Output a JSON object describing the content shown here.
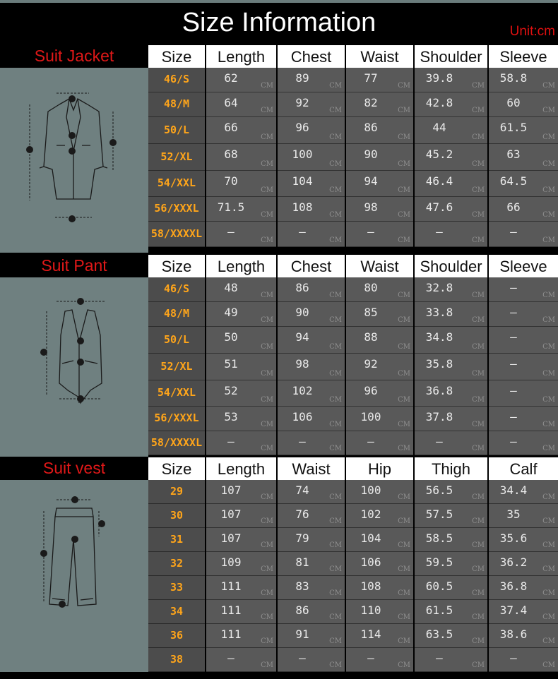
{
  "header": {
    "title": "Size Information",
    "unit": "Unit:cm"
  },
  "unit_label": "CM",
  "sections": [
    {
      "title": "Suit Jacket",
      "icon": "jacket-diagram-icon",
      "columns": [
        "Size",
        "Length",
        "Chest",
        "Waist",
        "Shoulder",
        "Sleeve"
      ],
      "rows": [
        {
          "size": "46/S",
          "values": [
            "62",
            "89",
            "77",
            "39.8",
            "58.8"
          ]
        },
        {
          "size": "48/M",
          "values": [
            "64",
            "92",
            "82",
            "42.8",
            "60"
          ]
        },
        {
          "size": "50/L",
          "values": [
            "66",
            "96",
            "86",
            "44",
            "61.5"
          ]
        },
        {
          "size": "52/XL",
          "values": [
            "68",
            "100",
            "90",
            "45.2",
            "63"
          ]
        },
        {
          "size": "54/XXL",
          "values": [
            "70",
            "104",
            "94",
            "46.4",
            "64.5"
          ]
        },
        {
          "size": "56/XXXL",
          "values": [
            "71.5",
            "108",
            "98",
            "47.6",
            "66"
          ]
        },
        {
          "size": "58/XXXXL",
          "values": [
            "—",
            "—",
            "—",
            "—",
            "—"
          ]
        }
      ]
    },
    {
      "title": "Suit Pant",
      "icon": "vest-diagram-icon",
      "columns": [
        "Size",
        "Length",
        "Chest",
        "Waist",
        "Shoulder",
        "Sleeve"
      ],
      "rows": [
        {
          "size": "46/S",
          "values": [
            "48",
            "86",
            "80",
            "32.8",
            "—"
          ]
        },
        {
          "size": "48/M",
          "values": [
            "49",
            "90",
            "85",
            "33.8",
            "—"
          ]
        },
        {
          "size": "50/L",
          "values": [
            "50",
            "94",
            "88",
            "34.8",
            "—"
          ]
        },
        {
          "size": "52/XL",
          "values": [
            "51",
            "98",
            "92",
            "35.8",
            "—"
          ]
        },
        {
          "size": "54/XXL",
          "values": [
            "52",
            "102",
            "96",
            "36.8",
            "—"
          ]
        },
        {
          "size": "56/XXXL",
          "values": [
            "53",
            "106",
            "100",
            "37.8",
            "—"
          ]
        },
        {
          "size": "58/XXXXL",
          "values": [
            "—",
            "—",
            "—",
            "—",
            "—"
          ]
        }
      ]
    },
    {
      "title": "Suit vest",
      "icon": "pants-diagram-icon",
      "columns": [
        "Size",
        "Length",
        "Waist",
        "Hip",
        "Thigh",
        "Calf"
      ],
      "rows": [
        {
          "size": "29",
          "values": [
            "107",
            "74",
            "100",
            "56.5",
            "34.4"
          ]
        },
        {
          "size": "30",
          "values": [
            "107",
            "76",
            "102",
            "57.5",
            "35"
          ]
        },
        {
          "size": "31",
          "values": [
            "107",
            "79",
            "104",
            "58.5",
            "35.6"
          ]
        },
        {
          "size": "32",
          "values": [
            "109",
            "81",
            "106",
            "59.5",
            "36.2"
          ]
        },
        {
          "size": "33",
          "values": [
            "111",
            "83",
            "108",
            "60.5",
            "36.8"
          ]
        },
        {
          "size": "34",
          "values": [
            "111",
            "86",
            "110",
            "61.5",
            "37.4"
          ]
        },
        {
          "size": "36",
          "values": [
            "111",
            "91",
            "114",
            "63.5",
            "38.6"
          ]
        },
        {
          "size": "38",
          "values": [
            "—",
            "—",
            "—",
            "—",
            "—"
          ]
        }
      ]
    }
  ]
}
